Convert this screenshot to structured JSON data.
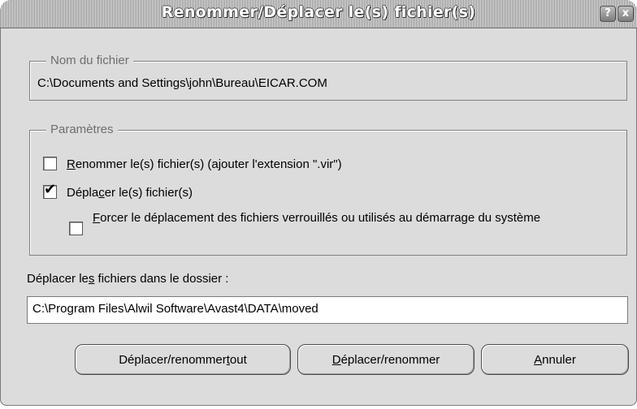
{
  "window": {
    "title": "Renommer/Déplacer le(s) fichier(s)",
    "help_icon": "?",
    "close_icon": "x"
  },
  "file_group": {
    "legend": "Nom du fichier",
    "path": "C:\\Documents and Settings\\john\\Bureau\\EICAR.COM"
  },
  "params_group": {
    "legend": "Paramètres",
    "options": [
      {
        "pre": "",
        "accel": "R",
        "post": "enommer le(s) fichier(s) (ajouter l'extension \".vir\")",
        "checked": false
      },
      {
        "pre": "Dépla",
        "accel": "c",
        "post": "er le(s) fichier(s)",
        "checked": true
      },
      {
        "pre": "",
        "accel": "F",
        "post": "orcer le déplacement des fichiers verrouillés ou utilisés au démarrage du système",
        "checked": false
      }
    ]
  },
  "destination": {
    "label_pre": "Déplacer le",
    "label_accel": "s",
    "label_post": " fichiers dans le dossier :",
    "value": "C:\\Program Files\\Alwil Software\\Avast4\\DATA\\moved"
  },
  "buttons": {
    "move_all": {
      "pre": "Déplacer/renommer ",
      "accel": "t",
      "post": "out"
    },
    "move": {
      "pre": "",
      "accel": "D",
      "post": "éplacer/renommer"
    },
    "cancel": {
      "pre": "",
      "accel": "A",
      "post": "nnuler"
    }
  }
}
